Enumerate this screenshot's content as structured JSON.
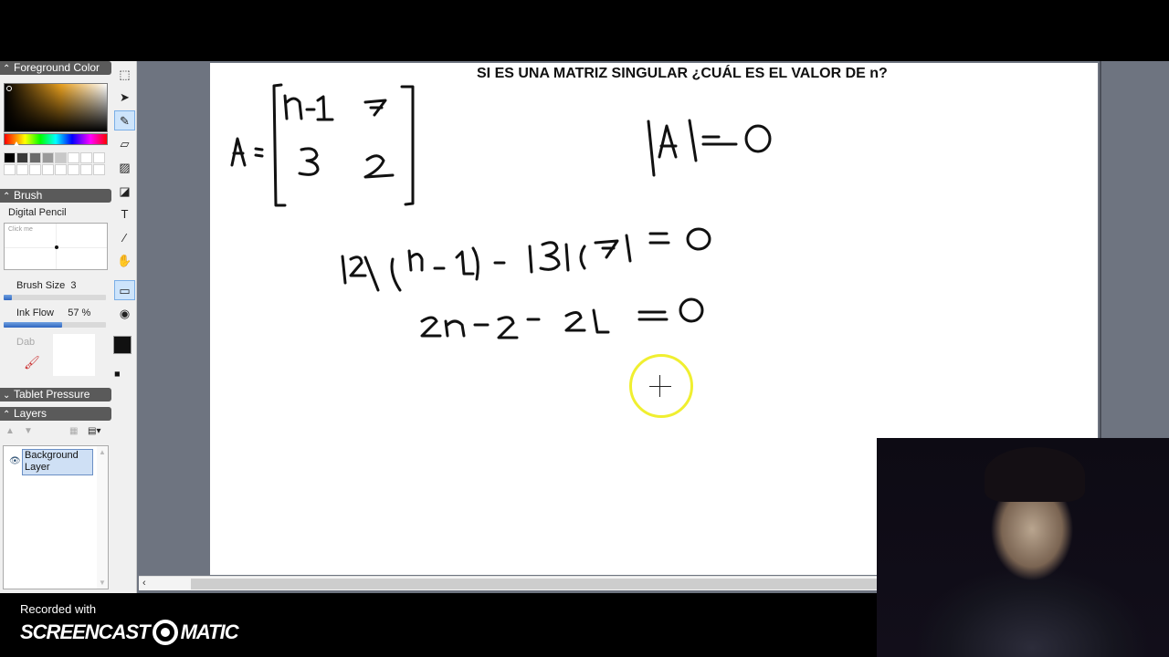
{
  "app": {
    "left_panel": {
      "foreground_color_header": "Foreground Color",
      "brush_header": "Brush",
      "brush_name": "Digital Pencil",
      "brush_preview_hint": "Click me",
      "brush_size_label": "Brush Size",
      "brush_size_value": "3",
      "brush_size_fraction": 0.08,
      "ink_flow_label": "Ink Flow",
      "ink_flow_value": "57 %",
      "ink_flow_fraction": 0.57,
      "dab_label": "Dab",
      "tablet_pressure_header": "Tablet Pressure",
      "layers_header": "Layers",
      "layers": [
        {
          "name": "Background Layer",
          "selected": true
        }
      ],
      "swatches": [
        "#000000",
        "#3a3a3a",
        "#6a6a6a",
        "#9a9a9a",
        "#c8c8c8",
        "#ffffff",
        "#ffffff",
        "#ffffff",
        "#ffffff",
        "#ffffff",
        "#ffffff",
        "#ffffff",
        "#ffffff",
        "#ffffff",
        "#ffffff",
        "#ffffff"
      ]
    },
    "toolbar": {
      "tools": [
        {
          "name": "select-rect",
          "icon": "⬚",
          "active": false
        },
        {
          "name": "move",
          "icon": "➤",
          "active": false
        },
        {
          "name": "brush",
          "icon": "✎",
          "active": true
        },
        {
          "name": "eraser",
          "icon": "▱",
          "active": false
        },
        {
          "name": "fill-image",
          "icon": "▨",
          "active": false
        },
        {
          "name": "bucket",
          "icon": "◪",
          "active": false
        },
        {
          "name": "text",
          "icon": "T",
          "active": false
        },
        {
          "name": "eyedropper",
          "icon": "⁄",
          "active": false
        },
        {
          "name": "hand",
          "icon": "✋",
          "active": false
        },
        {
          "name": "rectangle",
          "icon": "▭",
          "active": true
        },
        {
          "name": "record",
          "icon": "◉",
          "active": false
        }
      ],
      "foreground_color": "#111111",
      "background_color": "#ffffff"
    },
    "canvas": {
      "title": "SI ES UNA MATRIZ SINGULAR ¿CUÁL ES EL VALOR DE n?",
      "handwriting": [
        "A = [ n-1  7 ; 3  2 ]",
        "|A| = 0",
        "(2)(n-1) - (3)(7) = 0",
        "2n - 2 - 21 = 0"
      ],
      "cursor_ring_color": "#f0ef30"
    }
  },
  "watermark": {
    "recorded_with": "Recorded with",
    "brand_left": "SCREENCAST",
    "brand_right": "MATIC"
  }
}
